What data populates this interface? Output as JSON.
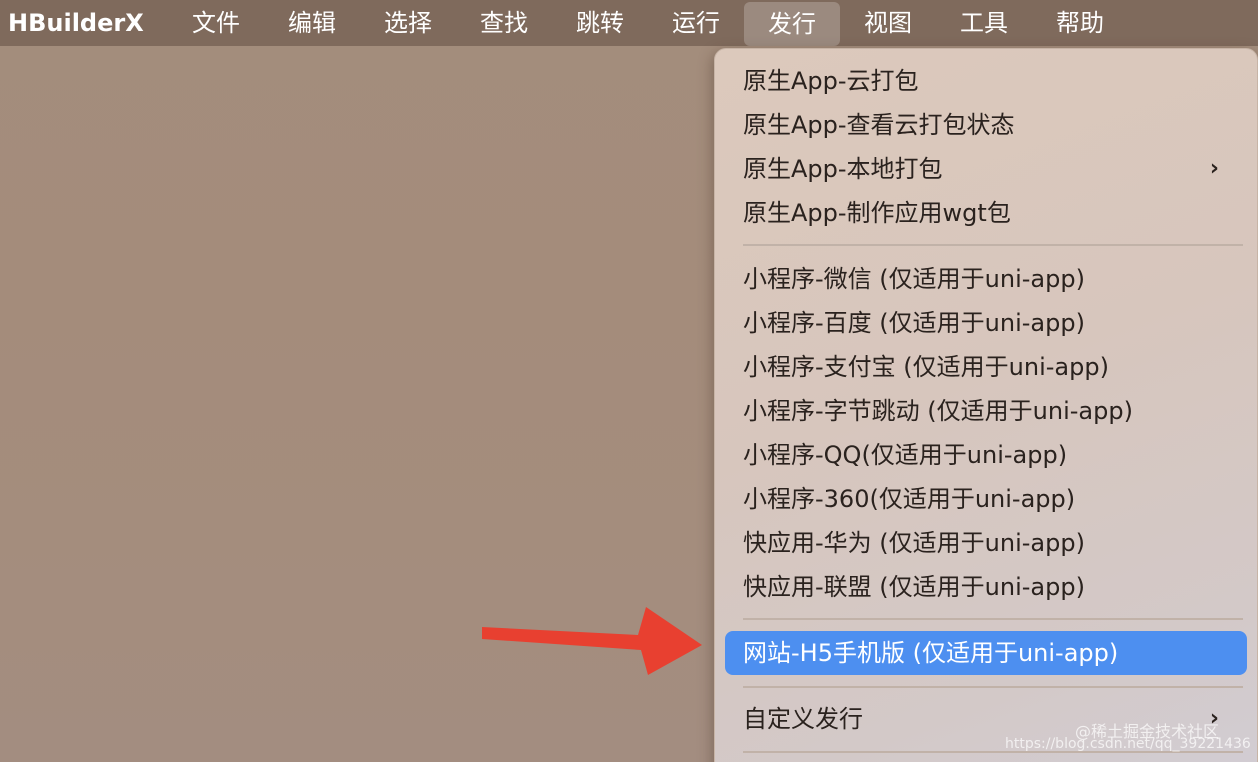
{
  "menubar": {
    "app_name": "HBuilderX",
    "items": [
      "文件",
      "编辑",
      "选择",
      "查找",
      "跳转",
      "运行",
      "发行",
      "视图",
      "工具",
      "帮助"
    ],
    "active_index": 6
  },
  "dropdown": {
    "items": [
      {
        "label": "原生App-云打包"
      },
      {
        "label": "原生App-查看云打包状态"
      },
      {
        "label": "原生App-本地打包",
        "submenu": "›"
      },
      {
        "label": "原生App-制作应用wgt包"
      },
      {
        "label": "小程序-微信 (仅适用于uni-app)"
      },
      {
        "label": "小程序-百度 (仅适用于uni-app)"
      },
      {
        "label": "小程序-支付宝 (仅适用于uni-app)"
      },
      {
        "label": "小程序-字节跳动 (仅适用于uni-app)"
      },
      {
        "label": "小程序-QQ(仅适用于uni-app)"
      },
      {
        "label": "小程序-360(仅适用于uni-app)"
      },
      {
        "label": "快应用-华为 (仅适用于uni-app)"
      },
      {
        "label": "快应用-联盟 (仅适用于uni-app)"
      },
      {
        "label": "网站-H5手机版 (仅适用于uni-app)"
      },
      {
        "label": "自定义发行",
        "submenu": "›"
      }
    ],
    "highlighted_index": 12
  },
  "colors": {
    "highlight": "#4d8ff0",
    "arrow": "#e84030"
  },
  "watermark": {
    "line1": "@稀土掘金技术社区",
    "line2": "https://blog.csdn.net/qq_39221436"
  }
}
